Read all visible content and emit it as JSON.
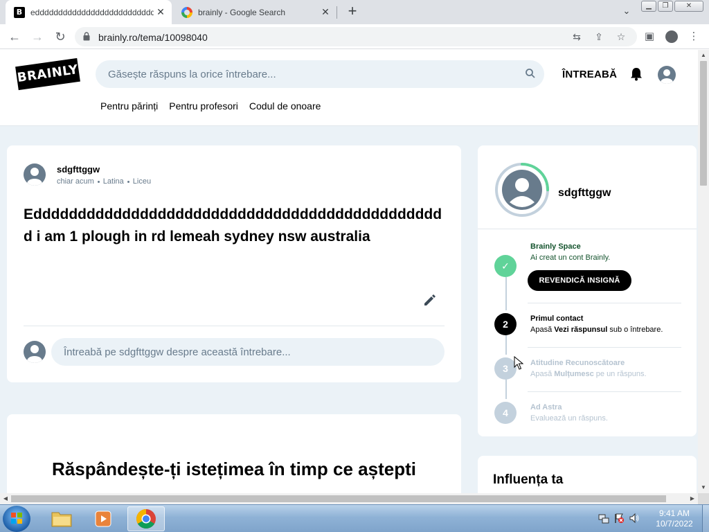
{
  "browser": {
    "tabs": [
      {
        "title": "eddddddddddddddddddddddddddd",
        "favicon": "brainly-favicon",
        "active": true
      },
      {
        "title": "brainly - Google Search",
        "favicon": "google-favicon",
        "active": false
      }
    ],
    "new_tab": "+",
    "url": "brainly.ro/tema/10098040"
  },
  "header": {
    "logo": "BRAINLY",
    "search_placeholder": "Găsește răspuns la orice întrebare...",
    "ask_label": "ÎNTREABĂ",
    "nav": [
      "Pentru părinți",
      "Pentru profesori",
      "Codul de onoare"
    ]
  },
  "question": {
    "username": "sdgfttggw",
    "meta": [
      "chiar acum",
      "Latina",
      "Liceu"
    ],
    "text": "Eddddddddddddddddddddddddddddddddddddddddddddddd i am 1 plough in rd lemeah sydney nsw australia",
    "comment_placeholder": "Întreabă pe sdgfttggw despre această întrebare..."
  },
  "promo": {
    "title": "Răspândește-ți istețimea în timp ce aștepti"
  },
  "sidebar": {
    "username": "sdgfttggw",
    "progress": 0.25,
    "steps": [
      {
        "marker": "✓",
        "title": "Brainly Space",
        "desc": "Ai creat un cont Brainly.",
        "state": "done",
        "button": "REVENDICĂ INSIGNĂ"
      },
      {
        "marker": "2",
        "title": "Primul contact",
        "desc_parts": [
          "Apasă ",
          "Vezi răspunsul",
          " sub o întrebare."
        ],
        "state": "current"
      },
      {
        "marker": "3",
        "title": "Atitudine Recunoscătoare",
        "desc_parts": [
          "Apasă ",
          "Mulțumesc",
          " pe un răspuns."
        ],
        "state": "locked"
      },
      {
        "marker": "4",
        "title": "Ad Astra",
        "desc": "Evaluează un răspuns.",
        "state": "locked"
      }
    ],
    "influence_title": "Influența ta"
  },
  "taskbar": {
    "time": "9:41 AM",
    "date": "10/7/2022"
  },
  "colors": {
    "accent_green": "#60d399",
    "page_bg": "#ebf2f7",
    "muted": "#687b8c",
    "step_green_text": "#14532d"
  }
}
